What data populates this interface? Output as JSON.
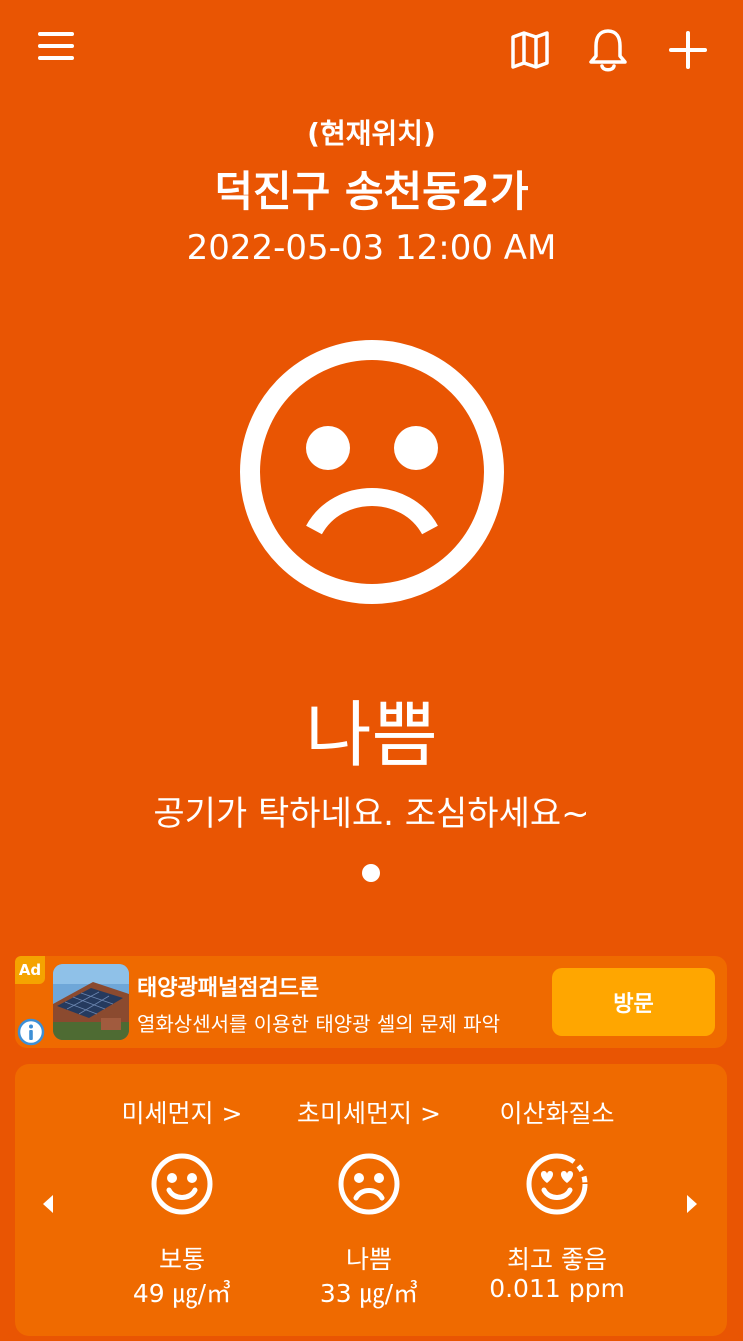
{
  "header": {
    "menu_icon": "hamburger-menu-icon",
    "map_icon": "map-icon",
    "bell_icon": "bell-icon",
    "add_icon": "plus-icon"
  },
  "location": {
    "label": "(현재위치)",
    "name": "덕진구 송천동2가",
    "datetime": "2022-05-03 12:00 AM"
  },
  "air_quality": {
    "face_icon": "sad-face-icon",
    "status": "나쁨",
    "message": "공기가 탁하네요. 조심하세요~"
  },
  "ad": {
    "badge": "Ad",
    "title": "태양광패널점검드론",
    "description": "열화상센서를 이용한 태양광 셀의 문제 파악",
    "button": "방문"
  },
  "metrics": [
    {
      "title": "미세먼지 >",
      "icon": "smile-face-icon",
      "status": "보통",
      "value": "49 ㎍/㎥"
    },
    {
      "title": "초미세먼지 >",
      "icon": "sad-face-icon",
      "status": "나쁨",
      "value": "33 ㎍/㎥"
    },
    {
      "title": "이산화질소",
      "icon": "heart-eyes-face-icon",
      "status": "최고 좋음",
      "value": "0.011 ppm"
    }
  ],
  "colors": {
    "background": "#E95503",
    "card": "#EF6A00",
    "ad_button": "#FFA600"
  }
}
